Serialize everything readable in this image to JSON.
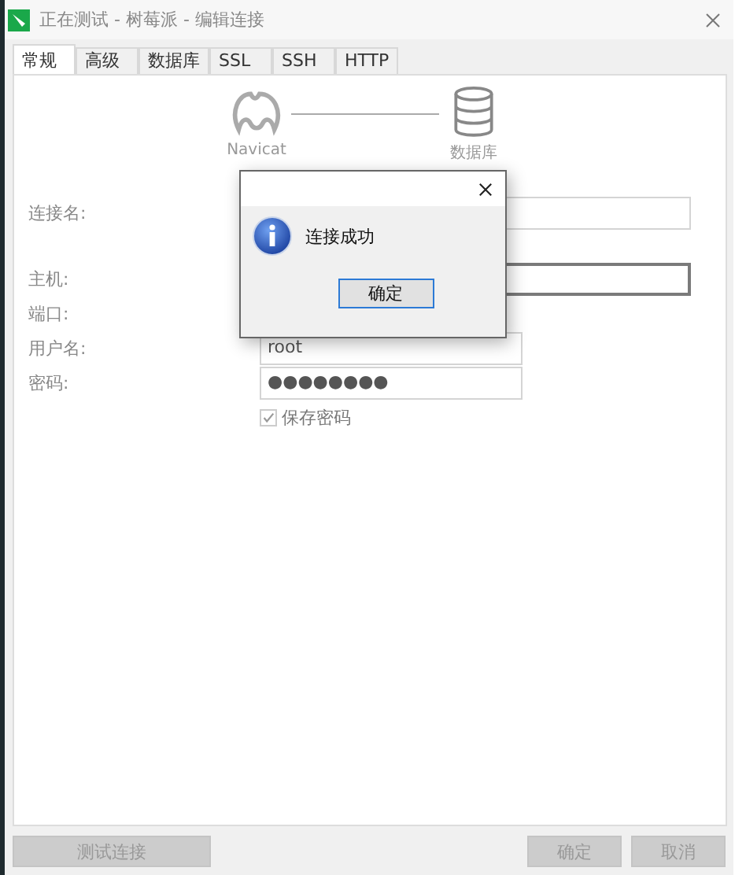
{
  "window": {
    "title": "正在测试 - 树莓派 - 编辑连接"
  },
  "tabs": [
    {
      "label": "常规",
      "selected": true
    },
    {
      "label": "高级",
      "selected": false
    },
    {
      "label": "数据库",
      "selected": false
    },
    {
      "label": "SSL",
      "selected": false
    },
    {
      "label": "SSH",
      "selected": false
    },
    {
      "label": "HTTP",
      "selected": false
    }
  ],
  "diagram": {
    "source": "Navicat",
    "target": "数据库"
  },
  "fields": [
    {
      "label": "连接名:",
      "kind": "wide",
      "focused": false
    },
    {
      "label": "主机:",
      "kind": "wide",
      "focused": true
    },
    {
      "label": "端口:",
      "kind": "none"
    },
    {
      "label": "用户名:",
      "kind": "narrow",
      "value": "root",
      "focused": false
    },
    {
      "label": "密码:",
      "kind": "narrow",
      "value": "●●●●●●●●",
      "focused": false
    }
  ],
  "save_password": {
    "label": "保存密码",
    "checked": true
  },
  "buttons": {
    "test": "测试连接",
    "ok": "确定",
    "cancel": "取消"
  },
  "dialog": {
    "message": "连接成功",
    "button": "确定"
  }
}
